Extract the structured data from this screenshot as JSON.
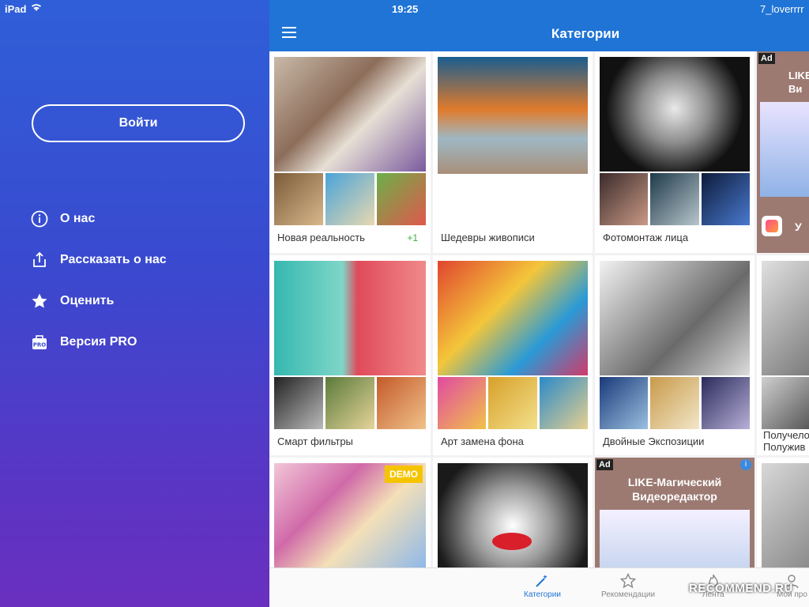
{
  "status": {
    "carrier": "iPad",
    "time": "19:25",
    "user_right": "7_loverrrr"
  },
  "sidebar": {
    "login_label": "Войти",
    "items": [
      {
        "label": "О нас",
        "icon": "info-icon"
      },
      {
        "label": "Рассказать о нас",
        "icon": "share-icon"
      },
      {
        "label": "Оценить",
        "icon": "star-icon"
      },
      {
        "label": "Версия PRO",
        "icon": "pro-icon"
      }
    ]
  },
  "header": {
    "title": "Категории"
  },
  "categories": [
    {
      "label": "Новая реальность",
      "badge": "+1"
    },
    {
      "label": "Шедевры живописи"
    },
    {
      "label": "Фотомонтаж лица"
    },
    {
      "label": "Смарт фильтры"
    },
    {
      "label": "Арт замена фона"
    },
    {
      "label": "Двойные Экспозиции"
    },
    {
      "label": "Получело Полужив"
    }
  ],
  "ads": [
    {
      "tag": "Ad",
      "title": "LIKE Ви",
      "cta": "У"
    },
    {
      "tag": "Ad",
      "title": "LIKE-Магический Видеоредактор"
    }
  ],
  "row3": {
    "demo_badge": "DEMO"
  },
  "tabs": [
    {
      "label": "Категории",
      "active": true
    },
    {
      "label": "Рекомендации"
    },
    {
      "label": "Лента"
    },
    {
      "label": "Мой про"
    }
  ],
  "watermark": "RECOMMEND.RU",
  "colors": {
    "accent": "#1f74d5",
    "sidebar_top": "#2f5fd8",
    "sidebar_bottom": "#6a2fbf",
    "demo": "#f5c400"
  }
}
